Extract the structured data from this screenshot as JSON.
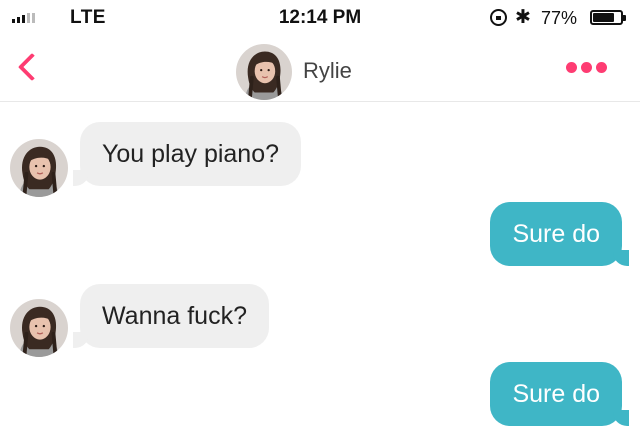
{
  "status_bar": {
    "carrier": "LTE",
    "time": "12:14 PM",
    "battery_percent": "77%",
    "battery_level": 0.77,
    "signal_bars_filled": 3,
    "icons": [
      "signal-icon",
      "orientation-lock-icon",
      "bluetooth-icon",
      "battery-icon"
    ]
  },
  "header": {
    "contact_name": "Rylie",
    "back_icon": "chevron-left-icon",
    "more_icon": "more-dots-icon",
    "accent_color": "#fe3c72"
  },
  "messages": [
    {
      "direction": "incoming",
      "text": "You play piano?"
    },
    {
      "direction": "outgoing",
      "text": "Sure do"
    },
    {
      "direction": "incoming",
      "text": "Wanna fuck?"
    },
    {
      "direction": "outgoing",
      "text": "Sure do"
    }
  ],
  "colors": {
    "outgoing_bubble": "#3fb6c6",
    "incoming_bubble": "#efefef"
  }
}
